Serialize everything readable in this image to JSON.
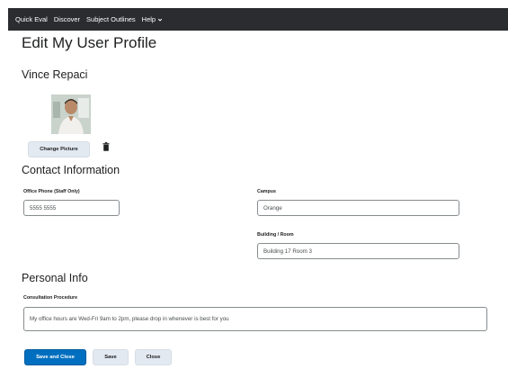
{
  "nav": {
    "items": [
      "Quick Eval",
      "Discover",
      "Subject Outlines",
      "Help"
    ]
  },
  "page": {
    "title": "Edit My User Profile"
  },
  "user": {
    "name": "Vince Repaci"
  },
  "picture": {
    "change_label": "Change Picture"
  },
  "contact": {
    "heading": "Contact Information",
    "office_phone_label": "Office Phone (Staff Only)",
    "office_phone_value": "5555 5555",
    "campus_label": "Campus",
    "campus_value": "Orange",
    "building_label": "Building / Room",
    "building_value": "Building 17 Room 3"
  },
  "personal": {
    "heading": "Personal Info",
    "consultation_label": "Consultation Procedure",
    "consultation_value": "My office hours are Wed-Fri 9am to 2pm, please drop in whenever is best for you"
  },
  "actions": {
    "save_close_label": "Save and Close",
    "save_label": "Save",
    "close_label": "Close"
  },
  "colors": {
    "navbar": "#2a2c30",
    "primary": "#006fbf",
    "secondary": "#e3e9f1"
  }
}
